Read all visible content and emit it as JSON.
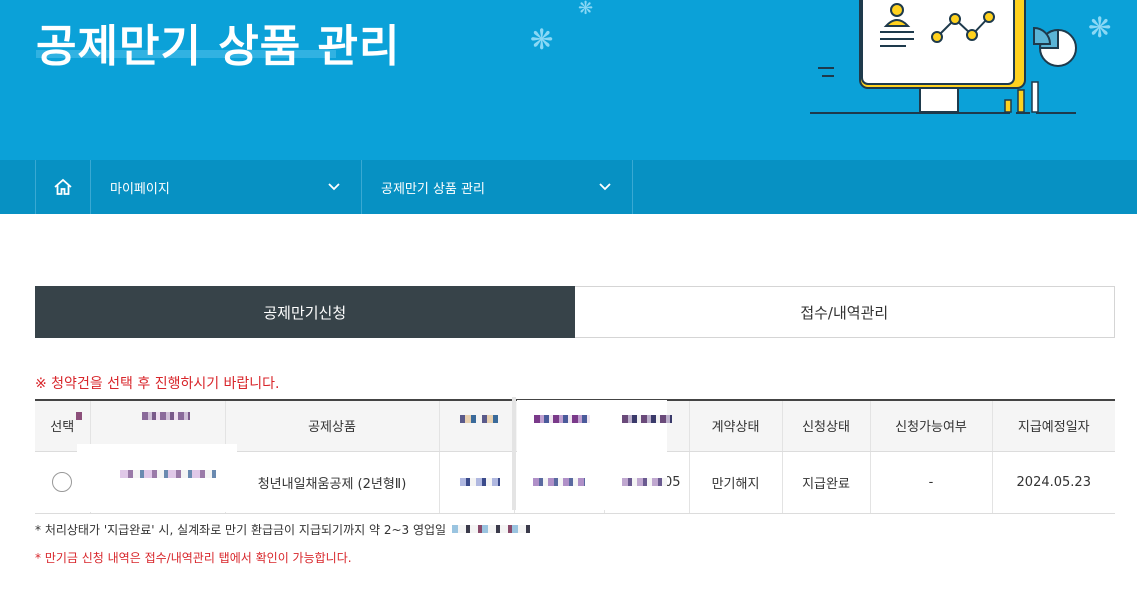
{
  "banner": {
    "title": "공제만기 상품 관리"
  },
  "nav": {
    "items": [
      {
        "label": "마이페이지"
      },
      {
        "label": "공제만기 상품 관리"
      }
    ]
  },
  "tabs": [
    {
      "label": "공제만기신청",
      "active": true
    },
    {
      "label": "접수/내역관리",
      "active": false
    }
  ],
  "notice": "※ 청약건을 선택 후 진행하시기 바랍니다.",
  "table": {
    "headers": [
      "선택",
      "",
      "공제상품",
      "",
      "",
      "",
      "계약상태",
      "신청상태",
      "신청가능여부",
      "지급예정일자"
    ],
    "rows": [
      {
        "selected": false,
        "product": "청년내일채움공제 (2년형Ⅱ)",
        "date_fragment": "05",
        "contract_status": "만기해지",
        "apply_status": "지급완료",
        "eligibility": "-",
        "payment_date": "2024.05.23"
      }
    ]
  },
  "notes": [
    "* 처리상태가 '지급완료' 시, 실계좌로 만기 환급금이 지급되기까지 약 2~3 영업일",
    "* 만기금 신청 내역은 접수/내역관리 탭에서 확인이 가능합니다."
  ],
  "colors": {
    "banner": "#0ba1d8",
    "nav": "#0791c3",
    "tab_active": "#374349",
    "notice": "#d8262b"
  },
  "icons": [
    "home-icon",
    "chevron-down-icon",
    "chevron-down-icon",
    "radio-icon"
  ]
}
